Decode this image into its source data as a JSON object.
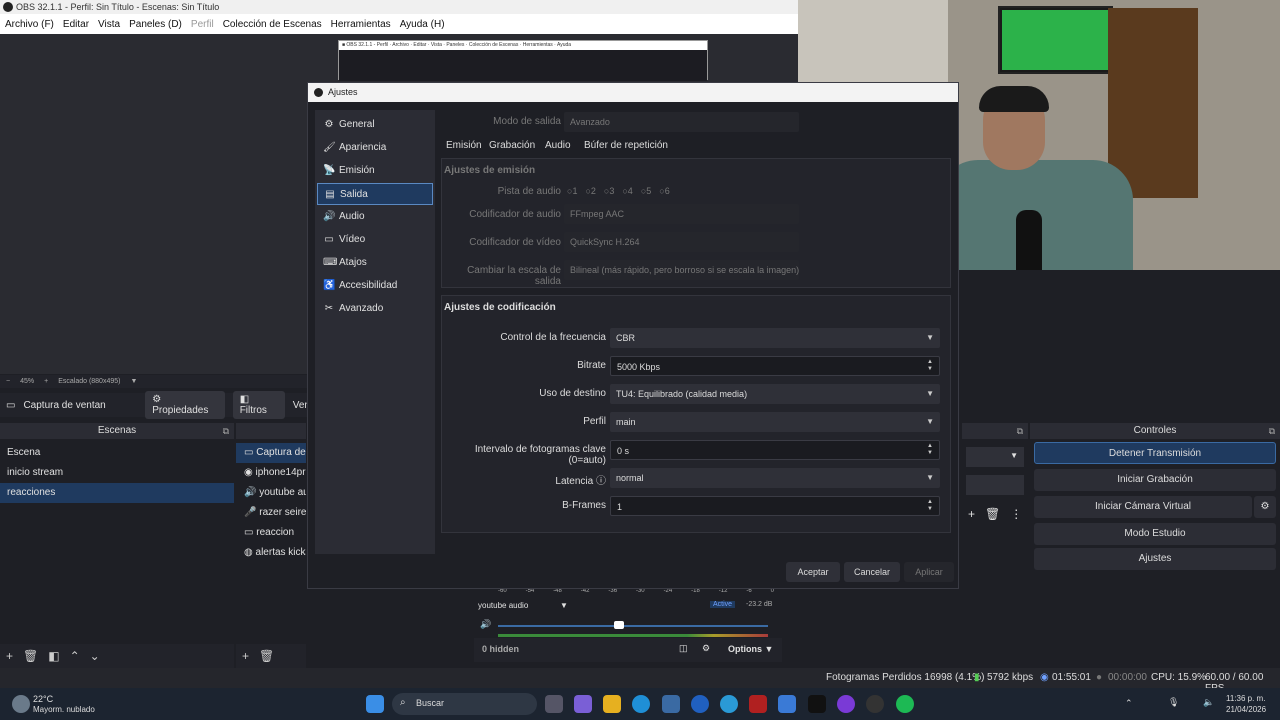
{
  "window": {
    "title": "OBS 32.1.1 - Perfil: Sin Título - Escenas: Sin Título"
  },
  "menu": [
    "Archivo (F)",
    "Editar",
    "Vista",
    "Paneles (D)",
    "Perfil",
    "Colección de Escenas",
    "Herramientas",
    "Ayuda (H)"
  ],
  "preview": {
    "zoom": "45%",
    "scaled": "Escalado (880x495)"
  },
  "source_toolbar": {
    "source": "Captura de ventan",
    "properties": "Propiedades",
    "filters": "Filtros",
    "more": "Ven"
  },
  "scenes": {
    "title": "Escenas",
    "items": [
      "Escena",
      "inicio stream",
      "reacciones"
    ],
    "selected": 2
  },
  "sources": {
    "items": [
      "Captura de v",
      "iphone14pr",
      "youtube au",
      "razer seiren",
      "reaccion",
      "alertas kicks"
    ]
  },
  "mixer": {
    "ticks": [
      "-60",
      "-54",
      "-48",
      "-42",
      "-36",
      "-30",
      "-24",
      "-18",
      "-12",
      "-6",
      "0"
    ],
    "channel": "youtube audio",
    "status": "Active",
    "db": "-23.2 dB",
    "hidden": "0 hidden",
    "options": "Options"
  },
  "controls": {
    "title": "Controles",
    "buttons": [
      "Detener Transmisión",
      "Iniciar Grabación",
      "Iniciar Cámara Virtual",
      "Modo Estudio",
      "Ajustes"
    ]
  },
  "status": {
    "dropped": "Fotogramas Perdidos 16998 (4.1%)",
    "kbps": "5792 kbps",
    "live": "01:55:01",
    "rec": "00:00:00",
    "cpu": "CPU: 15.9%",
    "fps": "60.00 / 60.00 FPS"
  },
  "taskbar": {
    "temp": "22°C",
    "weather": "Mayorm. nublado",
    "search": "Buscar",
    "time": "11:36 p. m.",
    "date": "21/04/2026"
  },
  "dialog": {
    "title": "Ajustes",
    "sidebar": [
      {
        "label": "General",
        "icon": "gear-icon"
      },
      {
        "label": "Apariencia",
        "icon": "paint-icon"
      },
      {
        "label": "Emisión",
        "icon": "broadcast-icon"
      },
      {
        "label": "Salida",
        "icon": "output-icon"
      },
      {
        "label": "Audio",
        "icon": "speaker-icon"
      },
      {
        "label": "Vídeo",
        "icon": "monitor-icon"
      },
      {
        "label": "Atajos",
        "icon": "keyboard-icon"
      },
      {
        "label": "Accesibilidad",
        "icon": "accessibility-icon"
      },
      {
        "label": "Avanzado",
        "icon": "wrench-icon"
      }
    ],
    "selected": 3,
    "output_mode_label": "Modo de salida",
    "output_mode": "Avanzado",
    "tabs": [
      "Emisión",
      "Grabación",
      "Audio",
      "Búfer de repetición"
    ],
    "emission_section": "Ajustes de emisión",
    "audio_track_label": "Pista de audio",
    "audio_tracks": [
      "1",
      "2",
      "3",
      "4",
      "5",
      "6"
    ],
    "audio_encoder_label": "Codificador de audio",
    "audio_encoder": "FFmpeg AAC",
    "video_encoder_label": "Codificador de vídeo",
    "video_encoder": "QuickSync H.264",
    "rescale_label": "Cambiar la escala de salida",
    "rescale": "Bilineal (más rápido, pero borroso si se escala la imagen)",
    "coding_section": "Ajustes de codificación",
    "fields": [
      {
        "label": "Control de la frecuencia",
        "value": "CBR",
        "kind": "select"
      },
      {
        "label": "Bitrate",
        "value": "5000 Kbps",
        "kind": "spin"
      },
      {
        "label": "Uso de destino",
        "value": "TU4: Equilibrado (calidad media)",
        "kind": "select"
      },
      {
        "label": "Perfil",
        "value": "main",
        "kind": "select"
      },
      {
        "label": "Intervalo de fotogramas clave (0=auto)",
        "value": "0 s",
        "kind": "spin"
      },
      {
        "label": "Latencia",
        "value": "normal",
        "kind": "select"
      },
      {
        "label": "B-Frames",
        "value": "1",
        "kind": "spin"
      }
    ],
    "buttons": {
      "accept": "Aceptar",
      "cancel": "Cancelar",
      "apply": "Aplicar"
    }
  }
}
